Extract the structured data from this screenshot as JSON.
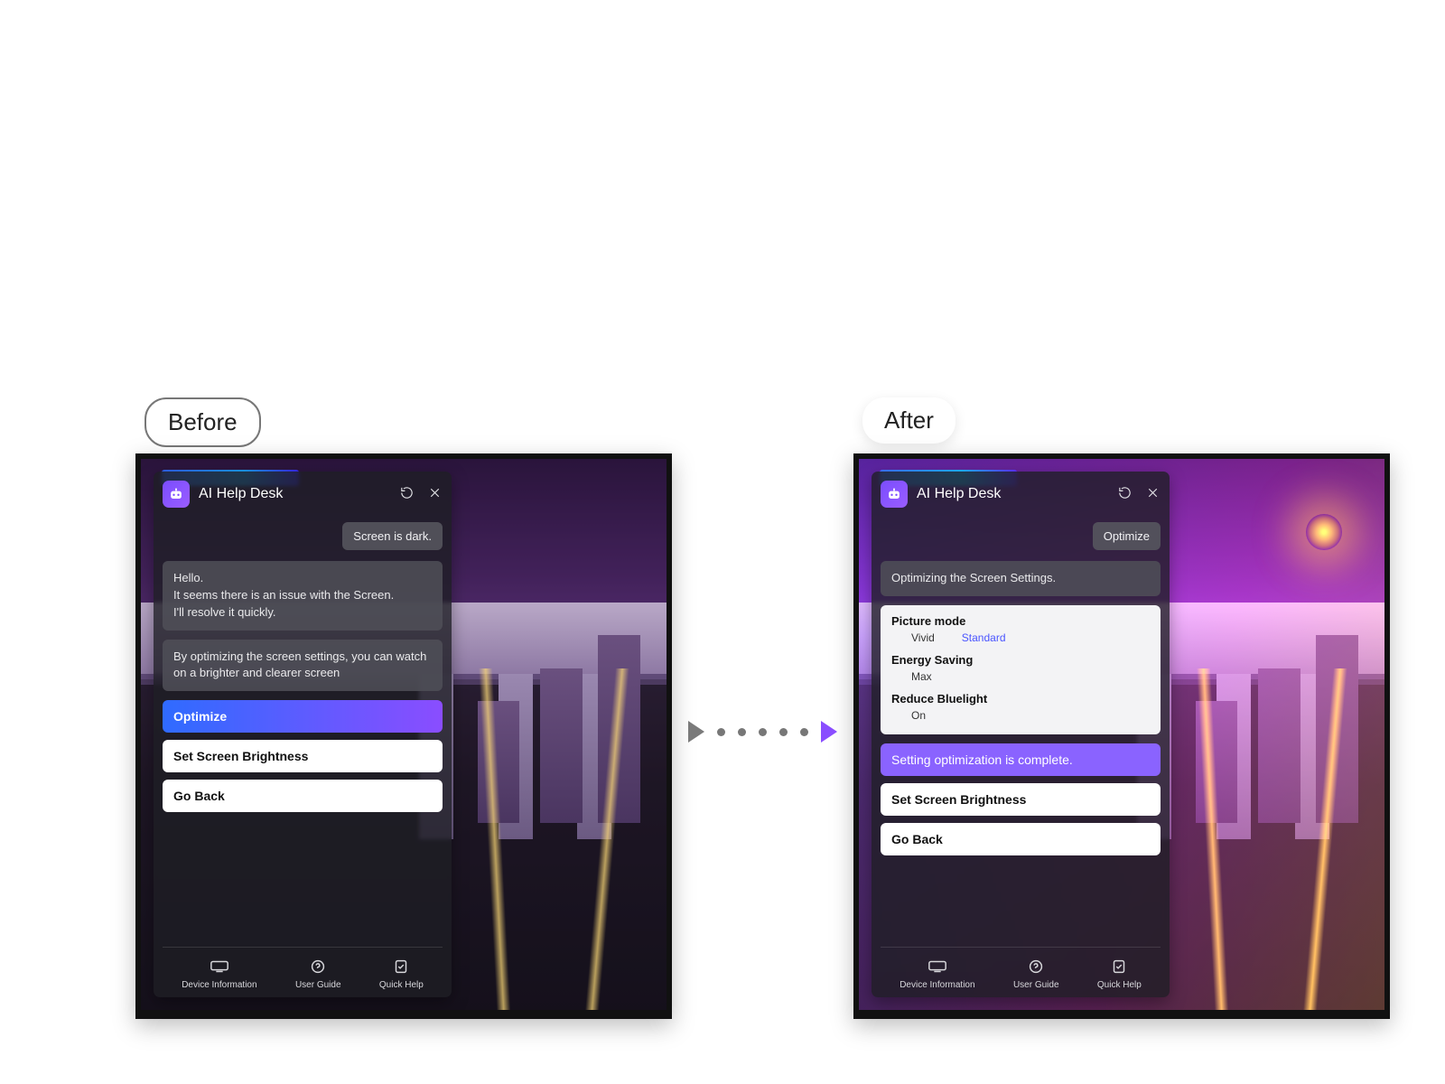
{
  "badges": {
    "before": "Before",
    "after": "After"
  },
  "left": {
    "panel": {
      "title": "AI Help Desk",
      "userBubble": "Screen is dark.",
      "sysBubble1": "Hello.\nIt seems there is an issue with the Screen.\nI'll resolve it quickly.",
      "sysBubble2": "By optimizing the screen settings, you can watch on a brighter and clearer screen",
      "btnOptimize": "Optimize",
      "btnBrightness": "Set Screen Brightness",
      "btnGoBack": "Go Back",
      "footer": {
        "deviceInfo": "Device Information",
        "userGuide": "User Guide",
        "quickHelp": "Quick Help"
      }
    }
  },
  "right": {
    "panel": {
      "title": "AI Help Desk",
      "userBubble": "Optimize",
      "sysBubble1": "Optimizing the Screen Settings.",
      "settings": [
        {
          "label": "Picture mode",
          "values": [
            "Vivid",
            "Standard"
          ],
          "accentIndex": 1
        },
        {
          "label": "Energy Saving",
          "values": [
            "Max"
          ]
        },
        {
          "label": "Reduce Bluelight",
          "values": [
            "On"
          ]
        }
      ],
      "statusMsg": "Setting optimization is complete.",
      "btnBrightness": "Set Screen Brightness",
      "btnGoBack": "Go Back",
      "footer": {
        "deviceInfo": "Device Information",
        "userGuide": "User Guide",
        "quickHelp": "Quick Help"
      }
    }
  }
}
